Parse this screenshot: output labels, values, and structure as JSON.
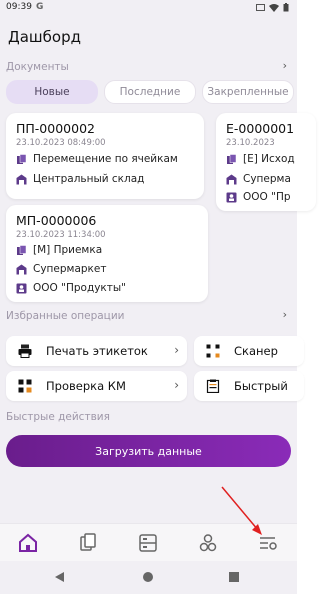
{
  "status": {
    "time": "09:39",
    "g_letter": "G"
  },
  "header": {
    "title": "Дашборд"
  },
  "sections": {
    "documents": "Документы",
    "favorites": "Избранные операции",
    "quick": "Быстрые действия"
  },
  "tabs": [
    {
      "label": "Новые",
      "active": true
    },
    {
      "label": "Последние",
      "active": false
    },
    {
      "label": "Закрепленные",
      "active": false
    }
  ],
  "cards": {
    "c1": {
      "number": "ПП-0000002",
      "date": "23.10.2023 08:49:00",
      "operation": "Перемещение по ячейкам",
      "warehouse": "Центральный склад"
    },
    "c2": {
      "number": "МП-0000006",
      "date": "23.10.2023 11:34:00",
      "operation": "[М] Приемка",
      "warehouse": "Супермаркет",
      "partner": "ООО \"Продукты\""
    },
    "c3": {
      "number": "Е-0000001",
      "date": "23.10.2023",
      "operation": "[Е] Исход",
      "warehouse": "Суперма",
      "partner": "ООО \"Пр"
    }
  },
  "ops": {
    "print_labels": "Печать этикеток",
    "scanner": "Сканер",
    "check_km": "Проверка КМ",
    "fast": "Быстрый"
  },
  "actions": {
    "load_data": "Загрузить данные"
  },
  "colors": {
    "accent": "#7a24a4",
    "background": "#f1eff4",
    "tab_active": "#e6ddf4"
  },
  "nav": {
    "items": [
      "home-icon",
      "documents-icon",
      "storage-icon",
      "operations-icon",
      "settings-icon"
    ],
    "active": "home-icon"
  }
}
